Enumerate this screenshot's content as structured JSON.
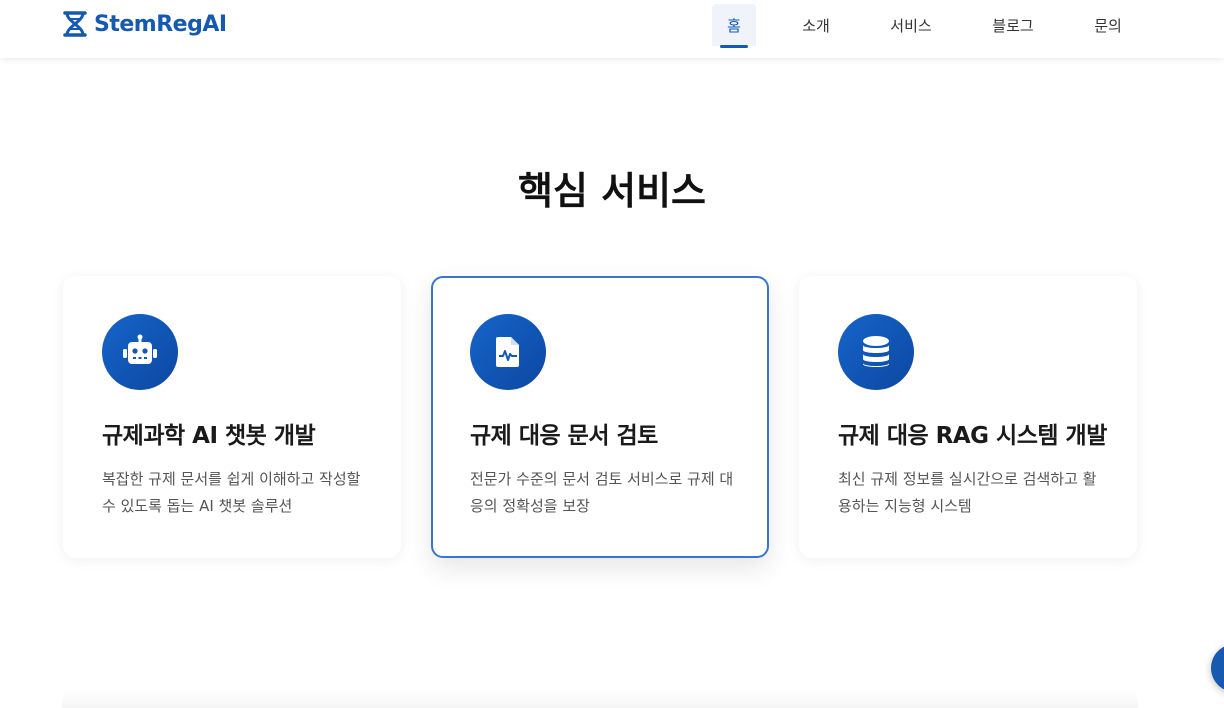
{
  "header": {
    "logo_text": "StemRegAI",
    "nav": [
      {
        "label": "홈",
        "active": true
      },
      {
        "label": "소개",
        "active": false
      },
      {
        "label": "서비스",
        "active": false
      },
      {
        "label": "블로그",
        "active": false
      },
      {
        "label": "문의",
        "active": false
      }
    ]
  },
  "section": {
    "title": "핵심 서비스",
    "cards": [
      {
        "icon": "robot-icon",
        "title": "규제과학 AI 챗봇 개발",
        "desc": "복잡한 규제 문서를 쉽게 이해하고 작성할 수 있도록 돕는 AI 챗봇 솔루션"
      },
      {
        "icon": "file-medical-icon",
        "title": "규제 대응 문서 검토",
        "desc": "전문가 수준의 문서 검토 서비스로 규제 대응의 정확성을 보장"
      },
      {
        "icon": "database-icon",
        "title": "규제 대응 RAG 시스템 개발",
        "desc": "최신 규제 정보를 실시간으로 검색하고 활용하는 지능형 시스템"
      }
    ]
  },
  "colors": {
    "brand": "#1559b0",
    "icon_gradient_start": "#1565c9",
    "icon_gradient_end": "#0d47a1",
    "highlight_border": "#3a76c8"
  }
}
